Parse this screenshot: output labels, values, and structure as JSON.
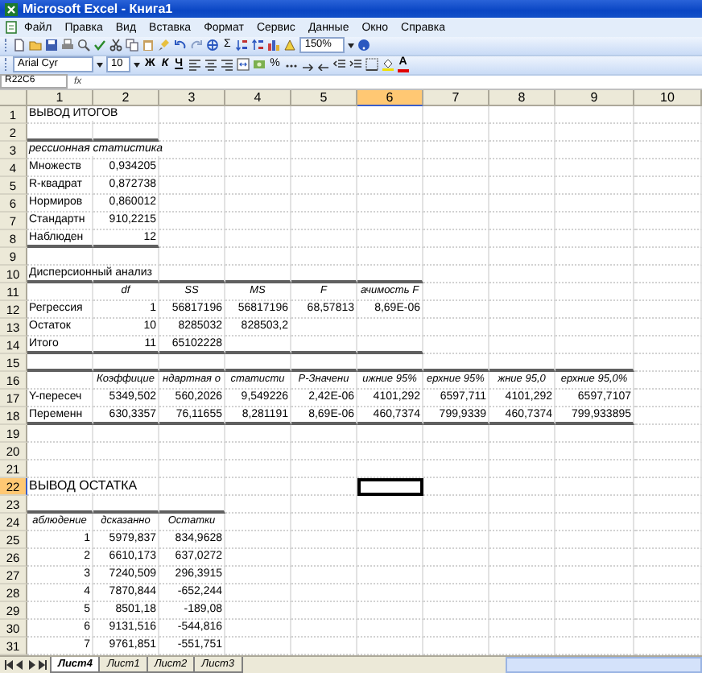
{
  "window": {
    "title": "Microsoft Excel - Книга1"
  },
  "menu": [
    "Файл",
    "Правка",
    "Вид",
    "Вставка",
    "Формат",
    "Сервис",
    "Данные",
    "Окно",
    "Справка"
  ],
  "standard_toolbar": {
    "sum": "Σ",
    "zoom": "150%"
  },
  "formatting_toolbar": {
    "font": "Arial Cyr",
    "size": "10",
    "bold": "Ж",
    "italic": "К",
    "underline": "Ч",
    "percent": "%",
    "font_color": "A"
  },
  "formula_bar": {
    "name_box": "R22C6",
    "fx": "fx"
  },
  "columns": [
    {
      "label": "1",
      "selected": false
    },
    {
      "label": "2",
      "selected": false
    },
    {
      "label": "3",
      "selected": false
    },
    {
      "label": "4",
      "selected": false
    },
    {
      "label": "5",
      "selected": false
    },
    {
      "label": "6",
      "selected": true
    },
    {
      "label": "7",
      "selected": false
    },
    {
      "label": "8",
      "selected": false
    },
    {
      "label": "9",
      "selected": false
    },
    {
      "label": "10",
      "selected": false
    }
  ],
  "rows": [
    {
      "number": "1",
      "selected": false,
      "cells": [
        {
          "kind": "label",
          "text": "ВЫВОД ИТОГОВ"
        }
      ]
    },
    {
      "number": "2",
      "selected": false,
      "cells": [
        {
          "rule": true
        },
        {
          "rule": true
        }
      ]
    },
    {
      "number": "3",
      "selected": false,
      "cells": [
        {
          "kind": "caption",
          "text": "рессионная статистика"
        }
      ]
    },
    {
      "number": "4",
      "selected": false,
      "cells": [
        {
          "kind": "label",
          "text": "Множеств"
        },
        {
          "kind": "number",
          "text": "0,934205"
        }
      ]
    },
    {
      "number": "5",
      "selected": false,
      "cells": [
        {
          "kind": "label",
          "text": "R-квадрат"
        },
        {
          "kind": "number",
          "text": "0,872738"
        }
      ]
    },
    {
      "number": "6",
      "selected": false,
      "cells": [
        {
          "kind": "label",
          "text": "Нормиров"
        },
        {
          "kind": "number",
          "text": "0,860012"
        }
      ]
    },
    {
      "number": "7",
      "selected": false,
      "cells": [
        {
          "kind": "label",
          "text": "Стандартн"
        },
        {
          "kind": "number",
          "text": "910,2215"
        }
      ]
    },
    {
      "number": "8",
      "selected": false,
      "cells": [
        {
          "kind": "label",
          "text": "Наблюден",
          "rule": true
        },
        {
          "kind": "number",
          "text": "12",
          "rule": true
        }
      ]
    },
    {
      "number": "9",
      "selected": false,
      "cells": []
    },
    {
      "number": "10",
      "selected": false,
      "cells": [
        {
          "kind": "label",
          "text": "Дисперсионный анализ",
          "rule": true
        },
        {
          "rule": true
        },
        {
          "rule": true
        },
        {
          "rule": true
        },
        {
          "rule": true
        },
        {
          "rule": true
        }
      ]
    },
    {
      "number": "11",
      "selected": false,
      "cells": [
        null,
        {
          "kind": "header",
          "text": "df"
        },
        {
          "kind": "header",
          "text": "SS"
        },
        {
          "kind": "header",
          "text": "MS"
        },
        {
          "kind": "header",
          "text": "F"
        },
        {
          "kind": "header",
          "text": "ачимость F"
        }
      ]
    },
    {
      "number": "12",
      "selected": false,
      "cells": [
        {
          "kind": "label",
          "text": "Регрессия"
        },
        {
          "kind": "number",
          "text": "1"
        },
        {
          "kind": "number",
          "text": "56817196"
        },
        {
          "kind": "number",
          "text": "56817196"
        },
        {
          "kind": "number",
          "text": "68,57813"
        },
        {
          "kind": "number",
          "text": "8,69E-06"
        }
      ]
    },
    {
      "number": "13",
      "selected": false,
      "cells": [
        {
          "kind": "label",
          "text": "Остаток"
        },
        {
          "kind": "number",
          "text": "10"
        },
        {
          "kind": "number",
          "text": "8285032"
        },
        {
          "kind": "number",
          "text": "828503,2"
        }
      ]
    },
    {
      "number": "14",
      "selected": false,
      "cells": [
        {
          "kind": "label",
          "text": "Итого",
          "rule": true
        },
        {
          "kind": "number",
          "text": "11",
          "rule": true
        },
        {
          "kind": "number",
          "text": "65102228",
          "rule": true
        },
        {
          "rule": true
        },
        {
          "rule": true
        },
        {
          "rule": true
        }
      ]
    },
    {
      "number": "15",
      "selected": false,
      "cells": [
        {
          "rule": true
        },
        {
          "rule": true
        },
        {
          "rule": true
        },
        {
          "rule": true
        },
        {
          "rule": true
        },
        {
          "rule": true
        },
        {
          "rule": true
        },
        {
          "rule": true
        },
        {
          "rule": true
        }
      ]
    },
    {
      "number": "16",
      "selected": false,
      "cells": [
        null,
        {
          "kind": "header",
          "text": "Коэффицие"
        },
        {
          "kind": "header",
          "text": "ндартная о"
        },
        {
          "kind": "header",
          "text": "статисти"
        },
        {
          "kind": "header",
          "text": "P-Значени"
        },
        {
          "kind": "header",
          "text": "ижние 95%"
        },
        {
          "kind": "header",
          "text": "ерхние 95%"
        },
        {
          "kind": "header",
          "text": "жние 95,0"
        },
        {
          "kind": "header",
          "text": "ерхние 95,0%"
        }
      ]
    },
    {
      "number": "17",
      "selected": false,
      "cells": [
        {
          "kind": "label",
          "text": "Y-пересеч"
        },
        {
          "kind": "number",
          "text": "5349,502"
        },
        {
          "kind": "number",
          "text": "560,2026"
        },
        {
          "kind": "number",
          "text": "9,549226"
        },
        {
          "kind": "number",
          "text": "2,42E-06"
        },
        {
          "kind": "number",
          "text": "4101,292"
        },
        {
          "kind": "number",
          "text": "6597,711"
        },
        {
          "kind": "number",
          "text": "4101,292"
        },
        {
          "kind": "number",
          "text": "6597,7107"
        }
      ]
    },
    {
      "number": "18",
      "selected": false,
      "cells": [
        {
          "kind": "label",
          "text": "Переменн",
          "rule": true
        },
        {
          "kind": "number",
          "text": "630,3357",
          "rule": true
        },
        {
          "kind": "number",
          "text": "76,11655",
          "rule": true
        },
        {
          "kind": "number",
          "text": "8,281191",
          "rule": true
        },
        {
          "kind": "number",
          "text": "8,69E-06",
          "rule": true
        },
        {
          "kind": "number",
          "text": "460,7374",
          "rule": true
        },
        {
          "kind": "number",
          "text": "799,9339",
          "rule": true
        },
        {
          "kind": "number",
          "text": "460,7374",
          "rule": true
        },
        {
          "kind": "number",
          "text": "799,933895",
          "rule": true
        }
      ]
    },
    {
      "number": "19",
      "selected": false,
      "cells": []
    },
    {
      "number": "20",
      "selected": false,
      "cells": []
    },
    {
      "number": "21",
      "selected": false,
      "cells": []
    },
    {
      "number": "22",
      "selected": true,
      "cells": [
        {
          "kind": "title",
          "text": "ВЫВОД ОСТАТКА"
        },
        null,
        null,
        null,
        null,
        {
          "selected": true
        }
      ]
    },
    {
      "number": "23",
      "selected": false,
      "cells": [
        {
          "rule": true
        },
        {
          "rule": true
        },
        {
          "rule": true
        }
      ]
    },
    {
      "number": "24",
      "selected": false,
      "cells": [
        {
          "kind": "header",
          "text": "аблюдение"
        },
        {
          "kind": "header",
          "text": "дсказанно"
        },
        {
          "kind": "header",
          "text": "Остатки"
        }
      ]
    },
    {
      "number": "25",
      "selected": false,
      "cells": [
        {
          "kind": "number",
          "text": "1"
        },
        {
          "kind": "number",
          "text": "5979,837"
        },
        {
          "kind": "number",
          "text": "834,9628"
        }
      ]
    },
    {
      "number": "26",
      "selected": false,
      "cells": [
        {
          "kind": "number",
          "text": "2"
        },
        {
          "kind": "number",
          "text": "6610,173"
        },
        {
          "kind": "number",
          "text": "637,0272"
        }
      ]
    },
    {
      "number": "27",
      "selected": false,
      "cells": [
        {
          "kind": "number",
          "text": "3"
        },
        {
          "kind": "number",
          "text": "7240,509"
        },
        {
          "kind": "number",
          "text": "296,3915"
        }
      ]
    },
    {
      "number": "28",
      "selected": false,
      "cells": [
        {
          "kind": "number",
          "text": "4"
        },
        {
          "kind": "number",
          "text": "7870,844"
        },
        {
          "kind": "number",
          "text": "-652,244"
        }
      ]
    },
    {
      "number": "29",
      "selected": false,
      "cells": [
        {
          "kind": "number",
          "text": "5"
        },
        {
          "kind": "number",
          "text": "8501,18"
        },
        {
          "kind": "number",
          "text": "-189,08"
        }
      ]
    },
    {
      "number": "30",
      "selected": false,
      "cells": [
        {
          "kind": "number",
          "text": "6"
        },
        {
          "kind": "number",
          "text": "9131,516"
        },
        {
          "kind": "number",
          "text": "-544,816"
        }
      ]
    },
    {
      "number": "31",
      "selected": false,
      "cells": [
        {
          "kind": "number",
          "text": "7"
        },
        {
          "kind": "number",
          "text": "9761,851"
        },
        {
          "kind": "number",
          "text": "-551,751"
        }
      ]
    }
  ],
  "sheet_tabs": [
    {
      "label": "Лист4",
      "selected": true
    },
    {
      "label": "Лист1",
      "selected": false
    },
    {
      "label": "Лист2",
      "selected": false
    },
    {
      "label": "Лист3",
      "selected": false
    }
  ]
}
